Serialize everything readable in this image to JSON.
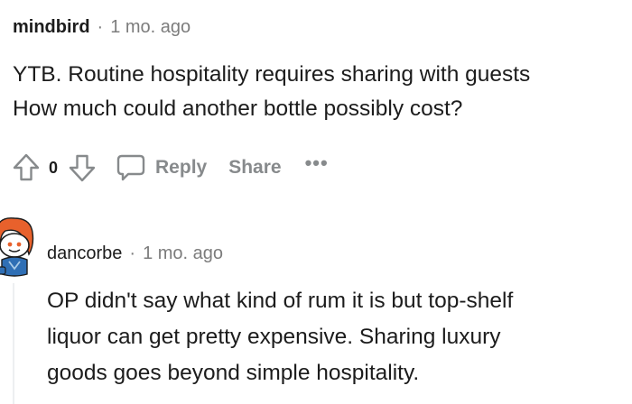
{
  "comments": [
    {
      "username": "mindbird",
      "separator": "·",
      "time": "1 mo. ago",
      "lines": [
        "YTB. Routine hospitality requires sharing with guests",
        "How much could another bottle possibly cost?"
      ],
      "vote_count": "0",
      "actions": {
        "reply": "Reply",
        "share": "Share",
        "more": "•••"
      }
    },
    {
      "username": "dancorbe",
      "separator": "·",
      "time": "1 mo. ago",
      "lines": [
        "OP didn't say what kind of rum it is but top-shelf",
        "liquor can get pretty expensive. Sharing luxury",
        "goods goes beyond simple hospitality."
      ]
    }
  ],
  "icons": {
    "upvote": "arrow-up-outline-icon",
    "downvote": "arrow-down-outline-icon",
    "reply": "speech-bubble-icon",
    "more": "ellipsis-icon",
    "avatar": "snoo-avatar-red-hair"
  },
  "colors": {
    "text": "#1c1c1c",
    "meta": "#7c7c7c",
    "action": "#878a8c",
    "thread_line": "#edeff1",
    "avatar_hair": "#e8612c"
  }
}
